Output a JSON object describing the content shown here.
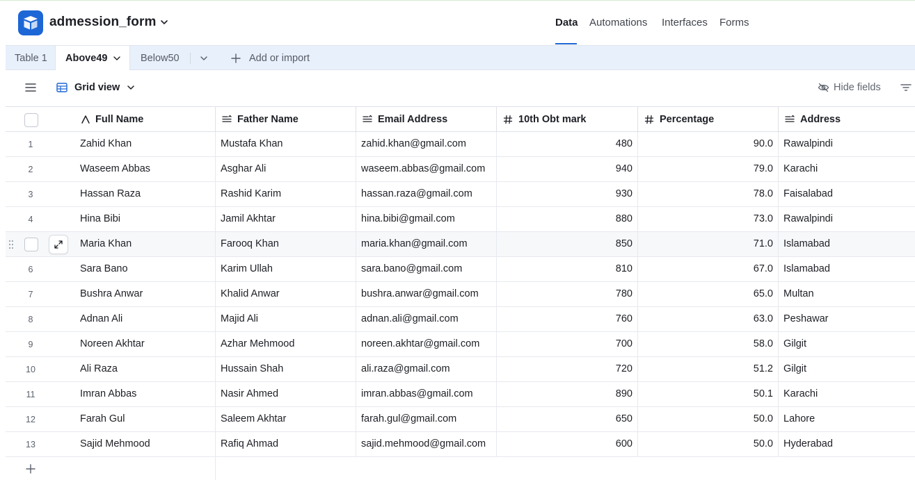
{
  "app": {
    "base_name": "admession_form",
    "brand_color": "#1d66d6"
  },
  "nav": [
    {
      "label": "Data",
      "active": true
    },
    {
      "label": "Automations",
      "active": false
    },
    {
      "label": "Interfaces",
      "active": false
    },
    {
      "label": "Forms",
      "active": false
    }
  ],
  "tabs": {
    "table1": "Table 1",
    "above49": "Above49",
    "below50": "Below50",
    "add_or_import": "Add or import"
  },
  "viewbar": {
    "view_name": "Grid view",
    "hide_fields": "Hide fields"
  },
  "columns": {
    "full_name": "Full Name",
    "father_name": "Father Name",
    "email": "Email Address",
    "obt_mark": "10th Obt mark",
    "percentage": "Percentage",
    "address": "Address"
  },
  "rows": [
    {
      "num": "1",
      "full_name": "Zahid Khan",
      "father_name": "Mustafa Khan",
      "email": "zahid.khan@gmail.com",
      "obt_mark": "480",
      "percentage": "90.0",
      "address": "Rawalpindi"
    },
    {
      "num": "2",
      "full_name": "Waseem Abbas",
      "father_name": "Asghar Ali",
      "email": "waseem.abbas@gmail.com",
      "obt_mark": "940",
      "percentage": "79.0",
      "address": "Karachi"
    },
    {
      "num": "3",
      "full_name": "Hassan Raza",
      "father_name": "Rashid Karim",
      "email": "hassan.raza@gmail.com",
      "obt_mark": "930",
      "percentage": "78.0",
      "address": "Faisalabad"
    },
    {
      "num": "4",
      "full_name": "Hina Bibi",
      "father_name": "Jamil Akhtar",
      "email": "hina.bibi@gmail.com",
      "obt_mark": "880",
      "percentage": "73.0",
      "address": "Rawalpindi"
    },
    {
      "num": "5",
      "full_name": "Maria Khan",
      "father_name": "Farooq Khan",
      "email": "maria.khan@gmail.com",
      "obt_mark": "850",
      "percentage": "71.0",
      "address": "Islamabad"
    },
    {
      "num": "6",
      "full_name": "Sara Bano",
      "father_name": "Karim Ullah",
      "email": "sara.bano@gmail.com",
      "obt_mark": "810",
      "percentage": "67.0",
      "address": "Islamabad"
    },
    {
      "num": "7",
      "full_name": "Bushra Anwar",
      "father_name": "Khalid Anwar",
      "email": "bushra.anwar@gmail.com",
      "obt_mark": "780",
      "percentage": "65.0",
      "address": "Multan"
    },
    {
      "num": "8",
      "full_name": "Adnan Ali",
      "father_name": "Majid Ali",
      "email": "adnan.ali@gmail.com",
      "obt_mark": "760",
      "percentage": "63.0",
      "address": "Peshawar"
    },
    {
      "num": "9",
      "full_name": "Noreen Akhtar",
      "father_name": "Azhar Mehmood",
      "email": "noreen.akhtar@gmail.com",
      "obt_mark": "700",
      "percentage": "58.0",
      "address": "Gilgit"
    },
    {
      "num": "10",
      "full_name": "Ali Raza",
      "father_name": "Hussain Shah",
      "email": "ali.raza@gmail.com",
      "obt_mark": "720",
      "percentage": "51.2",
      "address": "Gilgit"
    },
    {
      "num": "11",
      "full_name": "Imran Abbas",
      "father_name": "Nasir Ahmed",
      "email": "imran.abbas@gmail.com",
      "obt_mark": "890",
      "percentage": "50.1",
      "address": "Karachi"
    },
    {
      "num": "12",
      "full_name": "Farah Gul",
      "father_name": "Saleem Akhtar",
      "email": "farah.gul@gmail.com",
      "obt_mark": "650",
      "percentage": "50.0",
      "address": "Lahore"
    },
    {
      "num": "13",
      "full_name": "Sajid Mehmood",
      "father_name": "Rafiq Ahmad",
      "email": "sajid.mehmood@gmail.com",
      "obt_mark": "600",
      "percentage": "50.0",
      "address": "Hyderabad"
    }
  ]
}
